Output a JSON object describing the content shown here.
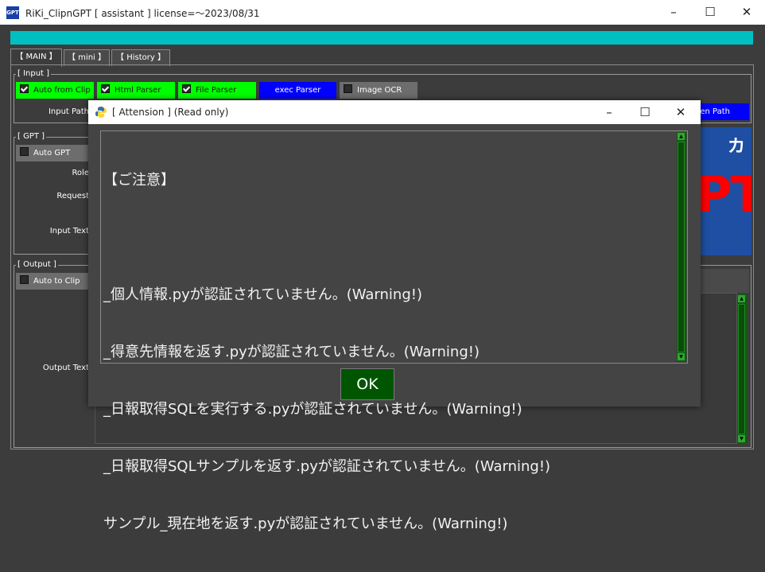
{
  "window": {
    "icon_text": "GPT",
    "title": "RiKi_ClipnGPT [ assistant ] license=～2023/08/31",
    "minimize": "–",
    "maximize": "☐",
    "close": "✕"
  },
  "tabs": [
    {
      "label": "【 MAIN 】",
      "active": true
    },
    {
      "label": "【 mini 】",
      "active": false
    },
    {
      "label": "【 History 】",
      "active": false
    }
  ],
  "input_frame": {
    "label": "[ Input ]",
    "buttons": [
      {
        "label": "Auto from Clip",
        "checked": true,
        "color": "#00ff00"
      },
      {
        "label": "Html Parser",
        "checked": true,
        "color": "#00ff00"
      },
      {
        "label": "File Parser",
        "checked": true,
        "color": "#00ff00"
      },
      {
        "label": "exec Parser",
        "color": "#0000ff"
      },
      {
        "label": "Image OCR",
        "checked": false,
        "color": "#6d6d6d"
      }
    ],
    "input_path_label": "Input Path",
    "open_path_label": "pen Path"
  },
  "gpt_frame": {
    "label": "[ GPT ]",
    "auto_gpt": {
      "label": "Auto GPT",
      "checked": false
    },
    "role_label": "Role",
    "request_label": "Request",
    "input_text_label": "Input Text",
    "banner_char": "カ",
    "banner_text": "PT"
  },
  "output_frame": {
    "label": "[ Output ]",
    "auto_to_clip": {
      "label": "Auto to Clip",
      "checked": false
    },
    "output_text_label": "Output Text"
  },
  "dialog": {
    "icon": "python-icon",
    "title": "[ Attension ] (Read only)",
    "minimize": "–",
    "maximize": "☐",
    "close": "✕",
    "lines": [
      "【ご注意】",
      "",
      "_個人情報.pyが認証されていません。(Warning!)",
      "_得意先情報を返す.pyが認証されていません。(Warning!)",
      "_日報取得SQLを実行する.pyが認証されていません。(Warning!)",
      "_日報取得SQLサンプルを返す.pyが認証されていません。(Warning!)",
      "サンプル_現在地を返す.pyが認証されていません。(Warning!)"
    ],
    "ok_label": "OK"
  },
  "colors": {
    "background": "#3c3c3c",
    "accent_teal": "#00bfc0",
    "check_green": "#00ff00",
    "exec_blue": "#0000ff",
    "ok_green": "#005500",
    "scroll_green": "#0d5c0d",
    "banner_red": "#ff0000"
  }
}
